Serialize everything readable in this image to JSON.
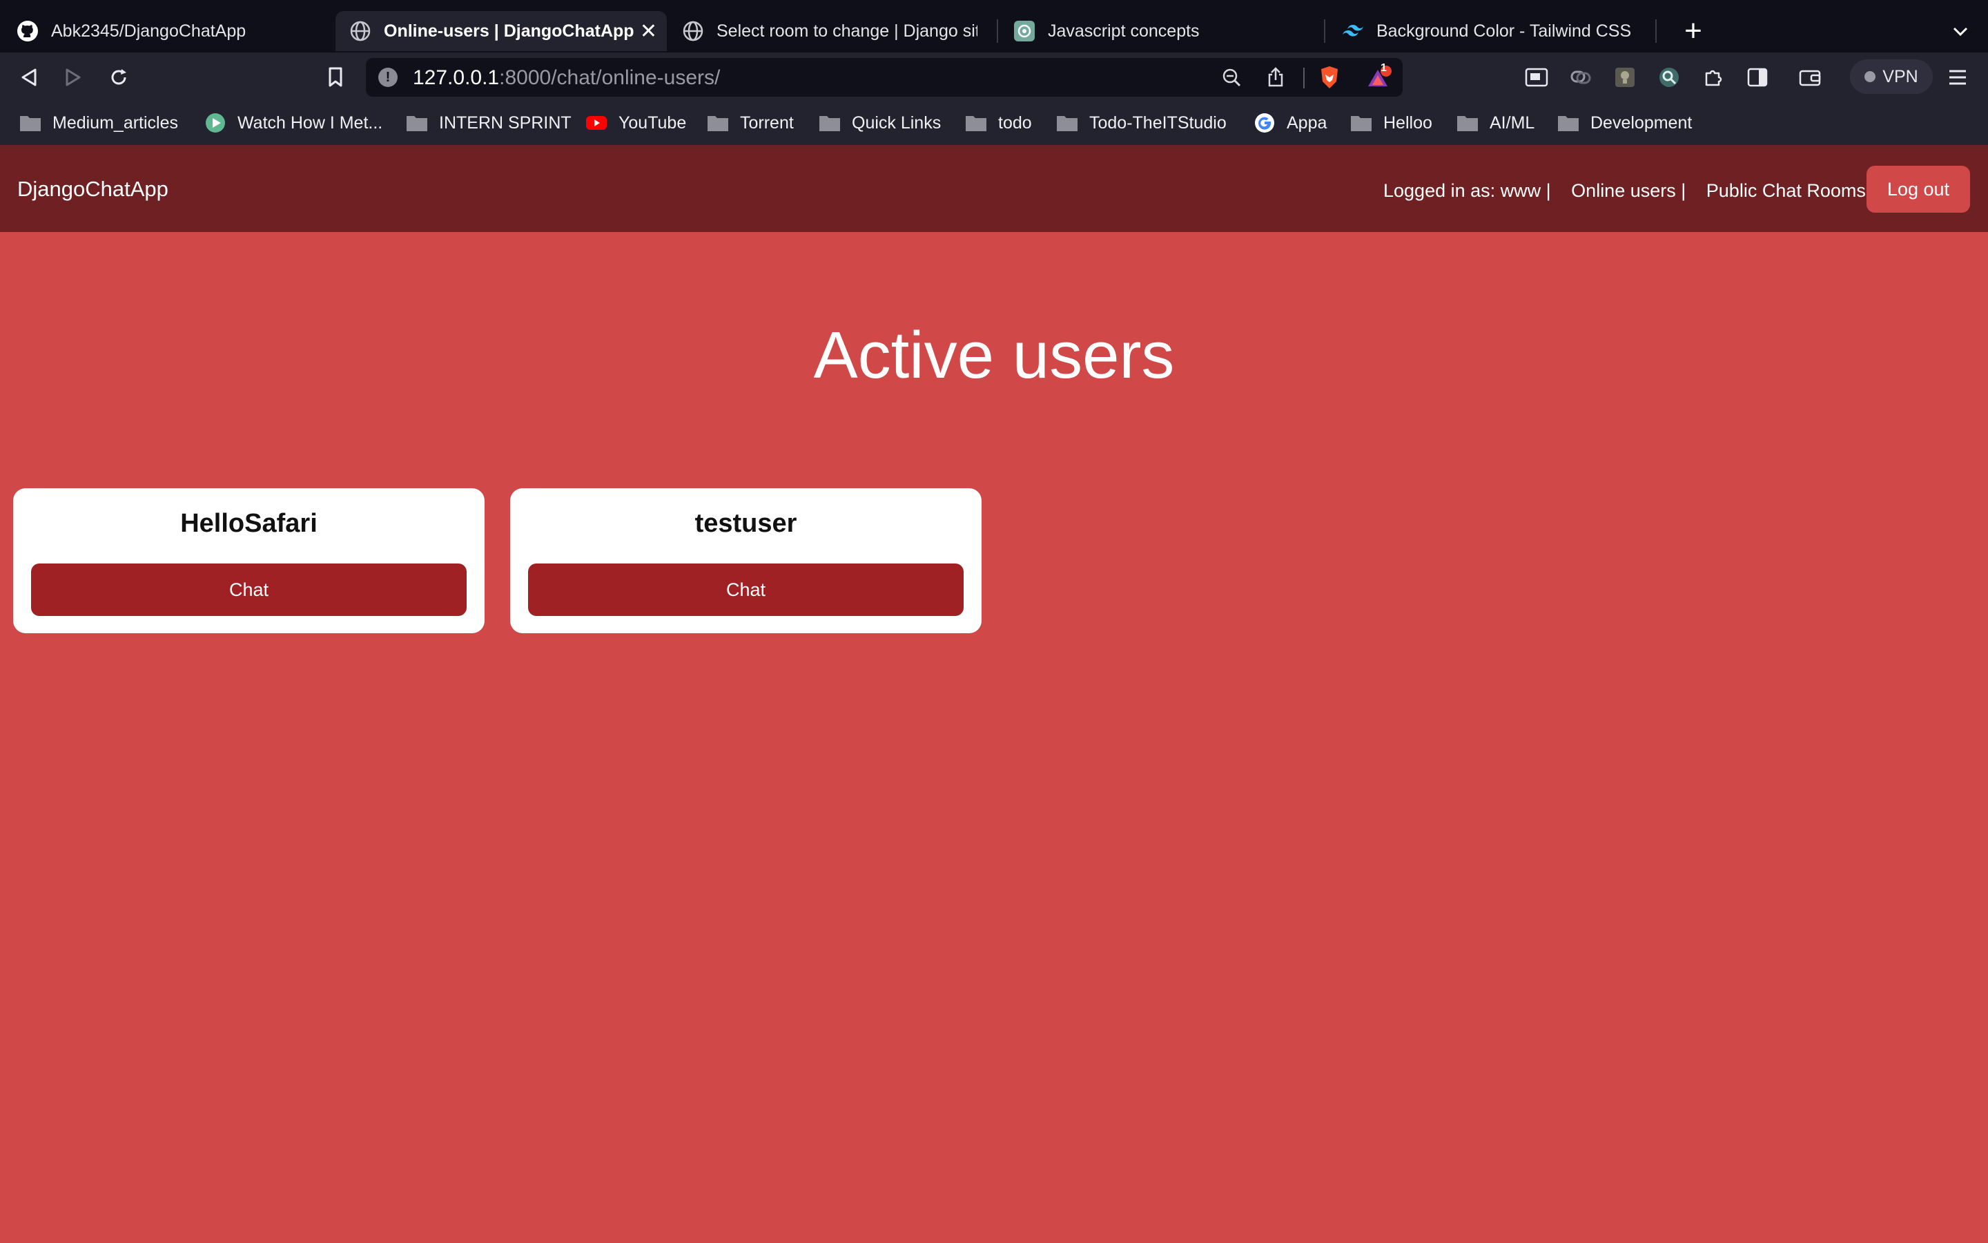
{
  "browser": {
    "tabs": [
      {
        "title": "Abk2345/DjangoChatApp",
        "icon": "github-icon"
      },
      {
        "title": "Online-users | DjangoChatApp",
        "icon": "globe-icon",
        "active": true
      },
      {
        "title": "Select room to change | Django site",
        "icon": "globe-icon"
      },
      {
        "title": "Javascript concepts",
        "icon": "openai-icon"
      },
      {
        "title": "Background Color - Tailwind CSS",
        "icon": "tailwind-icon"
      }
    ],
    "close_glyph": "✕",
    "new_tab_glyph": "+",
    "url_host": "127.0.0.1",
    "url_rest": ":8000/chat/online-users/",
    "brave_badge": "1",
    "vpn_label": "VPN",
    "bookmarks": [
      {
        "label": "Medium_articles",
        "icon": "folder-icon"
      },
      {
        "label": "Watch How I Met...",
        "icon": "play-icon"
      },
      {
        "label": "INTERN SPRINT",
        "icon": "folder-icon"
      },
      {
        "label": "YouTube",
        "icon": "youtube-icon"
      },
      {
        "label": "Torrent",
        "icon": "folder-icon"
      },
      {
        "label": "Quick Links",
        "icon": "folder-icon"
      },
      {
        "label": "todo",
        "icon": "folder-icon"
      },
      {
        "label": "Todo-TheITStudio",
        "icon": "folder-icon"
      },
      {
        "label": "Appa",
        "icon": "google-icon"
      },
      {
        "label": "Helloo",
        "icon": "folder-icon"
      },
      {
        "label": "AI/ML",
        "icon": "folder-icon"
      },
      {
        "label": "Development",
        "icon": "folder-icon"
      }
    ]
  },
  "page": {
    "brand": "DjangoChatApp",
    "logged_in": "Logged in as: www |",
    "online_users_link": "Online users |",
    "public_rooms_link": "Public Chat Rooms |",
    "logout_label": "Log out",
    "heading": "Active users",
    "users": [
      {
        "name": "HelloSafari",
        "button": "Chat"
      },
      {
        "name": "testuser",
        "button": "Chat"
      }
    ]
  },
  "colors": {
    "page_bg": "#d04848",
    "navbar_bg": "#6e2023",
    "chat_button": "#a02124",
    "logout_button": "#d04848"
  }
}
